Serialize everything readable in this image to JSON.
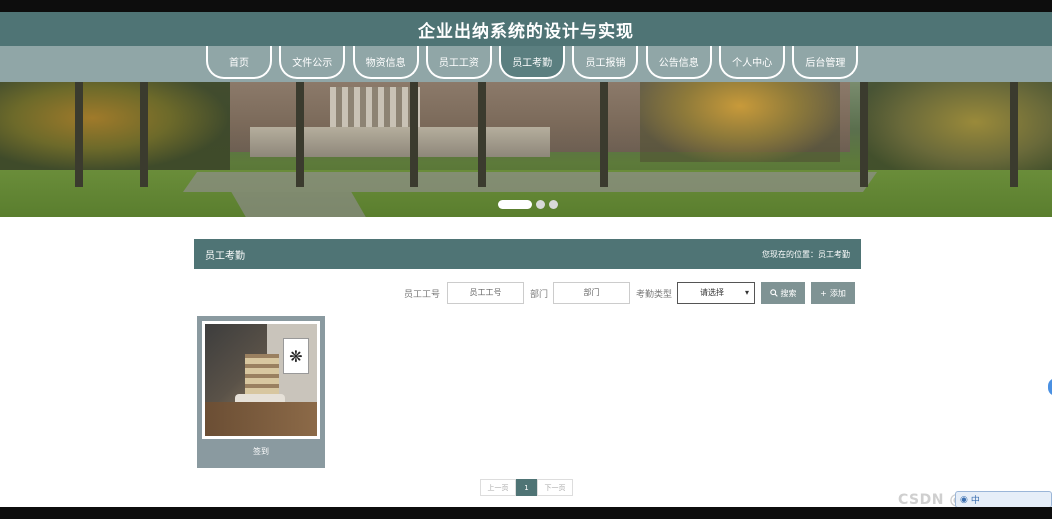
{
  "site": {
    "title": "企业出纳系统的设计与实现"
  },
  "nav": {
    "items": [
      {
        "label": "首页",
        "active": false
      },
      {
        "label": "文件公示",
        "active": false
      },
      {
        "label": "物资信息",
        "active": false
      },
      {
        "label": "员工工资",
        "active": false
      },
      {
        "label": "员工考勤",
        "active": true
      },
      {
        "label": "员工报销",
        "active": false
      },
      {
        "label": "公告信息",
        "active": false
      },
      {
        "label": "个人中心",
        "active": false
      },
      {
        "label": "后台管理",
        "active": false
      }
    ]
  },
  "carousel": {
    "slide_count": 3,
    "active_index": 0
  },
  "panel": {
    "title": "员工考勤",
    "location": "您现在的位置：员工考勤"
  },
  "search": {
    "emp_no_label": "员工工号",
    "emp_no_placeholder": "员工工号",
    "dept_label": "部门",
    "dept_placeholder": "部门",
    "type_label": "考勤类型",
    "type_selected": "请选择",
    "search_button": "搜索",
    "add_button": "添加"
  },
  "records": [
    {
      "name": "签到"
    }
  ],
  "pagination": {
    "prev": "上一页",
    "current": "1",
    "next": "下一页"
  },
  "overlay": {
    "watermark": "CSDN @lk0027",
    "translate_badge": "中"
  },
  "colors": {
    "primary": "#4f7475",
    "nav_bg": "#90a6a7",
    "button": "#7f9394"
  }
}
